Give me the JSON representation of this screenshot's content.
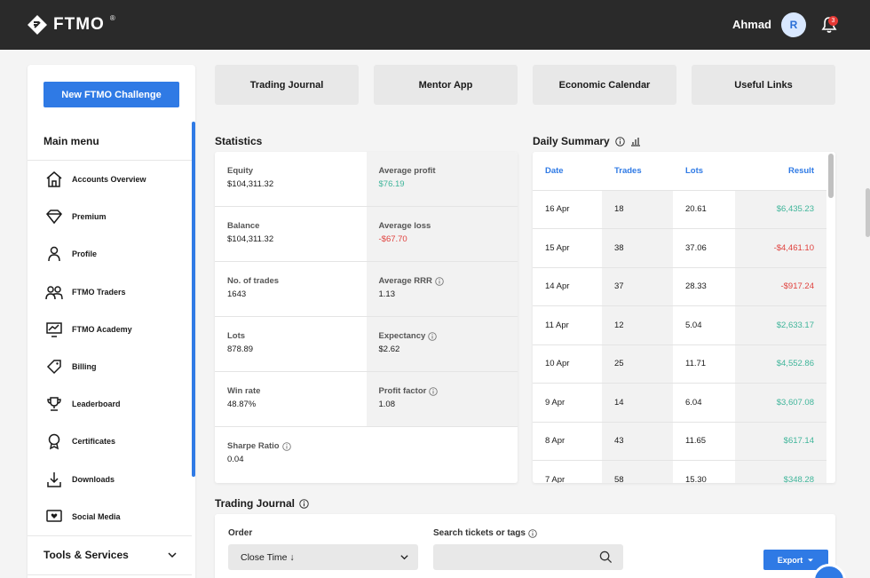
{
  "header": {
    "brand": "FTMO",
    "brand_mark": "®",
    "user_name": "Ahmad",
    "avatar_initial": "R",
    "notification_count": "3"
  },
  "sidebar": {
    "cta_label": "New FTMO Challenge",
    "menu_title": "Main menu",
    "items": [
      {
        "label": "Accounts Overview",
        "icon": "house-icon"
      },
      {
        "label": "Premium",
        "icon": "diamond-icon"
      },
      {
        "label": "Profile",
        "icon": "person-icon"
      },
      {
        "label": "FTMO Traders",
        "icon": "people-icon"
      },
      {
        "label": "FTMO Academy",
        "icon": "academy-icon"
      },
      {
        "label": "Billing",
        "icon": "tag-icon"
      },
      {
        "label": "Leaderboard",
        "icon": "trophy-icon"
      },
      {
        "label": "Certificates",
        "icon": "badge-icon"
      },
      {
        "label": "Downloads",
        "icon": "download-icon"
      },
      {
        "label": "Social Media",
        "icon": "heart-screen-icon"
      }
    ],
    "tools_title": "Tools & Services"
  },
  "quick_tabs": [
    "Trading Journal",
    "Mentor App",
    "Economic Calendar",
    "Useful Links"
  ],
  "statistics": {
    "title": "Statistics",
    "rows": [
      {
        "left": {
          "label": "Equity",
          "value": "$104,311.32"
        },
        "right": {
          "label": "Average profit",
          "value": "$76.19",
          "tone": "positive"
        }
      },
      {
        "left": {
          "label": "Balance",
          "value": "$104,311.32"
        },
        "right": {
          "label": "Average loss",
          "value": "-$67.70",
          "tone": "negative"
        }
      },
      {
        "left": {
          "label": "No. of trades",
          "value": "1643"
        },
        "right": {
          "label": "Average RRR",
          "value": "1.13",
          "info": true
        }
      },
      {
        "left": {
          "label": "Lots",
          "value": "878.89"
        },
        "right": {
          "label": "Expectancy",
          "value": "$2.62",
          "info": true
        }
      },
      {
        "left": {
          "label": "Win rate",
          "value": "48.87%"
        },
        "right": {
          "label": "Profit factor",
          "value": "1.08",
          "info": true
        }
      },
      {
        "left": {
          "label": "Sharpe Ratio",
          "value": "0.04",
          "info": true
        }
      }
    ]
  },
  "daily_summary": {
    "title": "Daily Summary",
    "columns": [
      "Date",
      "Trades",
      "Lots",
      "Result"
    ],
    "rows": [
      {
        "date": "16 Apr",
        "trades": "18",
        "lots": "20.61",
        "result": "$6,435.23",
        "tone": "positive"
      },
      {
        "date": "15 Apr",
        "trades": "38",
        "lots": "37.06",
        "result": "-$4,461.10",
        "tone": "negative"
      },
      {
        "date": "14 Apr",
        "trades": "37",
        "lots": "28.33",
        "result": "-$917.24",
        "tone": "negative"
      },
      {
        "date": "11 Apr",
        "trades": "12",
        "lots": "5.04",
        "result": "$2,633.17",
        "tone": "positive"
      },
      {
        "date": "10 Apr",
        "trades": "25",
        "lots": "11.71",
        "result": "$4,552.86",
        "tone": "positive"
      },
      {
        "date": "9 Apr",
        "trades": "14",
        "lots": "6.04",
        "result": "$3,607.08",
        "tone": "positive"
      },
      {
        "date": "8 Apr",
        "trades": "43",
        "lots": "11.65",
        "result": "$617.14",
        "tone": "positive"
      },
      {
        "date": "7 Apr",
        "trades": "58",
        "lots": "15.30",
        "result": "$348.28",
        "tone": "positive"
      }
    ]
  },
  "journal": {
    "title": "Trading Journal",
    "order_label": "Order",
    "order_value": "Close Time ↓",
    "search_label": "Search tickets or tags",
    "search_value": "",
    "export_label": "Export"
  },
  "colors": {
    "accent": "#2f7ae5",
    "positive": "#3fb59a",
    "negative": "#e0413d",
    "topbar": "#2a2a2a"
  }
}
